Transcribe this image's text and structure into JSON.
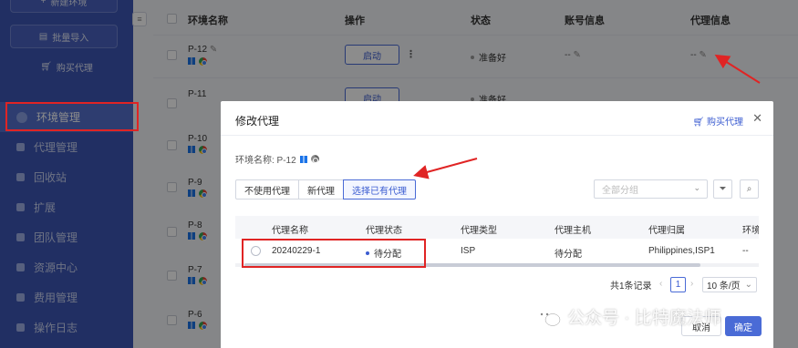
{
  "sidebar": {
    "new_env_label": "新建环境",
    "bulk_import_label": "批量导入",
    "buy_proxy_label": "购买代理",
    "items": [
      {
        "label": "环境管理",
        "active": true
      },
      {
        "label": "代理管理"
      },
      {
        "label": "回收站"
      },
      {
        "label": "扩展"
      },
      {
        "label": "团队管理"
      },
      {
        "label": "资源中心"
      },
      {
        "label": "费用管理"
      },
      {
        "label": "操作日志"
      }
    ]
  },
  "collapse_icon": "≡",
  "table": {
    "columns": {
      "name": "环境名称",
      "action": "操作",
      "status": "状态",
      "account": "账号信息",
      "proxy": "代理信息"
    },
    "start_label": "启动",
    "rows": [
      {
        "name": "P-12",
        "status": "准备好",
        "account": "--",
        "proxy": "--"
      },
      {
        "name": "P-11",
        "status": "准备好"
      },
      {
        "name": "P-10"
      },
      {
        "name": "P-9"
      },
      {
        "name": "P-8"
      },
      {
        "name": "P-7"
      },
      {
        "name": "P-6"
      }
    ]
  },
  "modal": {
    "title": "修改代理",
    "buy_proxy_label": "购买代理",
    "env_label": "环境名称: P-12",
    "tabs": [
      "不使用代理",
      "新代理",
      "选择已有代理"
    ],
    "group_placeholder": "全部分组",
    "proxy_table": {
      "headers": [
        "代理名称",
        "代理状态",
        "代理类型",
        "代理主机",
        "代理归属",
        "环境"
      ],
      "row": {
        "name": "20240229-1",
        "status": "待分配",
        "type": "ISP",
        "host": "待分配",
        "location": "Philippines,ISP1",
        "env": "--"
      }
    },
    "pagination": {
      "total": "共1条记录",
      "page": "1",
      "page_size": "10 条/页"
    },
    "cancel_label": "取消",
    "ok_label": "确定"
  },
  "watermark": "公众号 · 比特魔法师",
  "colors": {
    "sidebar": "#3d56b5",
    "primary": "#4a6bd6",
    "annotation": "#e02424"
  }
}
